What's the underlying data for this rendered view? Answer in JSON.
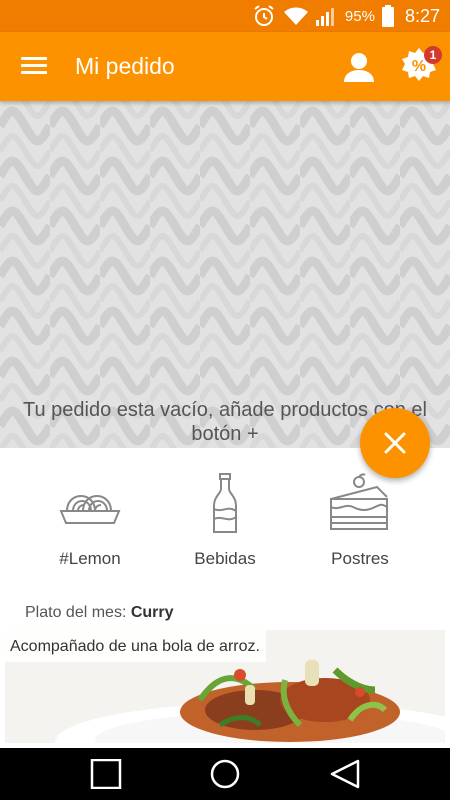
{
  "status_bar": {
    "battery": "95%",
    "time": "8:27"
  },
  "app_bar": {
    "title": "Mi pedido",
    "promo_badge": "1"
  },
  "empty_message": "Tu pedido esta vacío, añade productos con el botón +",
  "categories": [
    {
      "label": "#Lemon",
      "icon": "noodles-bowl-icon"
    },
    {
      "label": "Bebidas",
      "icon": "soda-bottle-icon"
    },
    {
      "label": "Postres",
      "icon": "cake-slice-icon"
    }
  ],
  "dish_of_month": {
    "prefix": "Plato del mes:",
    "name": "Curry",
    "caption": "Acompañado de una bola de arroz."
  },
  "colors": {
    "status_bar": "#f07d00",
    "primary": "#fd9200",
    "badge": "#d33a2c"
  }
}
